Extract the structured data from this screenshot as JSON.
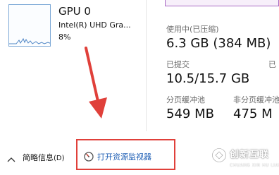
{
  "gpu": {
    "title": "GPU 0",
    "adapter": "Intel(R) UHD Gra...",
    "utilization": "8%"
  },
  "memory": {
    "in_use_label": "使用中(已压缩)",
    "in_use_value": "6.3 GB (384 MB)",
    "committed_label": "已提交",
    "committed_value": "10.5/15.7 GB",
    "committed_label_next": "已",
    "paged_pool_label": "分页缓冲池",
    "paged_pool_value": "549 MB",
    "nonpaged_pool_label": "非分页缓冲池",
    "nonpaged_pool_value": "475 M"
  },
  "footer": {
    "summary_label": "简略信息",
    "summary_hotkey": "(D)",
    "resource_monitor_link": "打开资源监视器"
  },
  "watermark": {
    "cn": "创新互联",
    "en": "CHUANG XIN HU LIAN"
  },
  "colors": {
    "accent_link": "#1f5fb5",
    "annotation_red": "#e0403a",
    "memory_purple": "#a86bc4",
    "gpu_blue": "#7aa7d6"
  }
}
